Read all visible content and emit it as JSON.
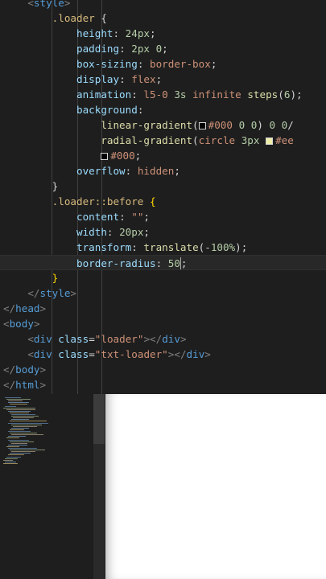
{
  "editor": {
    "lines": [
      [
        {
          "c": "t-br",
          "t": "    <"
        },
        {
          "c": "t-tag",
          "t": "style"
        },
        {
          "c": "t-br",
          "t": ">"
        }
      ],
      [
        {
          "c": "t-sel",
          "t": "        .loader "
        },
        {
          "c": "t-pl",
          "t": "{"
        }
      ],
      [
        {
          "c": "t-prop",
          "t": "            height"
        },
        {
          "c": "t-pl",
          "t": ": "
        },
        {
          "c": "t-num",
          "t": "24px"
        },
        {
          "c": "t-pl",
          "t": ";"
        }
      ],
      [
        {
          "c": "t-prop",
          "t": "            padding"
        },
        {
          "c": "t-pl",
          "t": ": "
        },
        {
          "c": "t-num",
          "t": "2px 0"
        },
        {
          "c": "t-pl",
          "t": ";"
        }
      ],
      [
        {
          "c": "t-prop",
          "t": "            box-sizing"
        },
        {
          "c": "t-pl",
          "t": ": "
        },
        {
          "c": "t-val",
          "t": "border-box"
        },
        {
          "c": "t-pl",
          "t": ";"
        }
      ],
      [
        {
          "c": "t-prop",
          "t": "            display"
        },
        {
          "c": "t-pl",
          "t": ": "
        },
        {
          "c": "t-val",
          "t": "flex"
        },
        {
          "c": "t-pl",
          "t": ";"
        }
      ],
      [
        {
          "c": "t-prop",
          "t": "            animation"
        },
        {
          "c": "t-pl",
          "t": ": "
        },
        {
          "c": "t-val",
          "t": "l5-0 "
        },
        {
          "c": "t-num",
          "t": "3s"
        },
        {
          "c": "t-val",
          "t": " infinite "
        },
        {
          "c": "t-fn",
          "t": "steps"
        },
        {
          "c": "t-pl",
          "t": "("
        },
        {
          "c": "t-num",
          "t": "6"
        },
        {
          "c": "t-pl",
          "t": ");"
        }
      ],
      [
        {
          "c": "t-prop",
          "t": "            background"
        },
        {
          "c": "t-pl",
          "t": ":"
        }
      ],
      [
        {
          "c": "t-fn",
          "t": "                linear-gradient"
        },
        {
          "c": "t-pl",
          "t": "("
        },
        {
          "c": "swatch",
          "t": "",
          "bg": "#000000"
        },
        {
          "c": "t-val",
          "t": "#000 "
        },
        {
          "c": "t-num",
          "t": "0 0"
        },
        {
          "c": "t-pl",
          "t": ") "
        },
        {
          "c": "t-num",
          "t": "0 0"
        },
        {
          "c": "t-pl",
          "t": "/"
        }
      ],
      [
        {
          "c": "t-fn",
          "t": "                radial-gradient"
        },
        {
          "c": "t-pl",
          "t": "("
        },
        {
          "c": "t-val",
          "t": "circle "
        },
        {
          "c": "t-num",
          "t": "3px "
        },
        {
          "c": "swatch",
          "t": "",
          "bg": "#eeeeaa"
        },
        {
          "c": "t-val",
          "t": "#ee"
        }
      ],
      [
        {
          "c": "t-pl",
          "t": "                "
        },
        {
          "c": "swatch",
          "t": "",
          "bg": "#000000"
        },
        {
          "c": "t-val",
          "t": "#000"
        },
        {
          "c": "t-pl",
          "t": ";"
        }
      ],
      [
        {
          "c": "t-prop",
          "t": "            overflow"
        },
        {
          "c": "t-pl",
          "t": ": "
        },
        {
          "c": "t-val",
          "t": "hidden"
        },
        {
          "c": "t-pl",
          "t": ";"
        }
      ],
      [
        {
          "c": "t-pl",
          "t": "        }"
        }
      ],
      [
        {
          "c": "t-sel",
          "t": "        .loader::before "
        },
        {
          "c": "t-brace",
          "t": "{"
        }
      ],
      [
        {
          "c": "t-prop",
          "t": "            content"
        },
        {
          "c": "t-pl",
          "t": ": "
        },
        {
          "c": "t-str",
          "t": "\"\""
        },
        {
          "c": "t-pl",
          "t": ";"
        }
      ],
      [
        {
          "c": "t-prop",
          "t": "            width"
        },
        {
          "c": "t-pl",
          "t": ": "
        },
        {
          "c": "t-num",
          "t": "20px"
        },
        {
          "c": "t-pl",
          "t": ";"
        }
      ],
      [
        {
          "c": "t-prop",
          "t": "            transform"
        },
        {
          "c": "t-pl",
          "t": ": "
        },
        {
          "c": "t-fn",
          "t": "translate"
        },
        {
          "c": "t-pl",
          "t": "("
        },
        {
          "c": "t-num",
          "t": "-100%"
        },
        {
          "c": "t-pl",
          "t": ");"
        }
      ],
      [
        {
          "c": "t-prop",
          "t": "            border-radius"
        },
        {
          "c": "t-pl",
          "t": ": "
        },
        {
          "c": "t-num",
          "t": "50"
        },
        {
          "c": "cursor",
          "t": ""
        },
        {
          "c": "t-pl",
          "t": ";"
        }
      ],
      [
        {
          "c": "t-brace",
          "t": "        }"
        }
      ],
      [
        {
          "c": "t-br",
          "t": "    </"
        },
        {
          "c": "t-tag",
          "t": "style"
        },
        {
          "c": "t-br",
          "t": ">"
        }
      ],
      [
        {
          "c": "t-br",
          "t": "</"
        },
        {
          "c": "t-tag",
          "t": "head"
        },
        {
          "c": "t-br",
          "t": ">"
        }
      ],
      [
        {
          "c": "t-br",
          "t": "<"
        },
        {
          "c": "t-tag",
          "t": "body"
        },
        {
          "c": "t-br",
          "t": ">"
        }
      ],
      [
        {
          "c": "t-br",
          "t": "    <"
        },
        {
          "c": "t-tag",
          "t": "div "
        },
        {
          "c": "t-attr",
          "t": "class"
        },
        {
          "c": "t-pl",
          "t": "="
        },
        {
          "c": "t-str",
          "t": "\"loader\""
        },
        {
          "c": "t-br",
          "t": "></"
        },
        {
          "c": "t-tag",
          "t": "div"
        },
        {
          "c": "t-br",
          "t": ">"
        }
      ],
      [
        {
          "c": "t-br",
          "t": "    <"
        },
        {
          "c": "t-tag",
          "t": "div "
        },
        {
          "c": "t-attr",
          "t": "class"
        },
        {
          "c": "t-pl",
          "t": "="
        },
        {
          "c": "t-str",
          "t": "\"txt-loader\""
        },
        {
          "c": "t-br",
          "t": "></"
        },
        {
          "c": "t-tag",
          "t": "div"
        },
        {
          "c": "t-br",
          "t": ">"
        }
      ],
      [
        {
          "c": "t-br",
          "t": "</"
        },
        {
          "c": "t-tag",
          "t": "body"
        },
        {
          "c": "t-br",
          "t": ">"
        }
      ],
      [
        {
          "c": "t-br",
          "t": "</"
        },
        {
          "c": "t-tag",
          "t": "html"
        },
        {
          "c": "t-br",
          "t": ">"
        }
      ]
    ],
    "current_line": 17
  },
  "colors": {
    "editor_bg": "#1e1e1e",
    "preview_bg": "#ffffff"
  }
}
